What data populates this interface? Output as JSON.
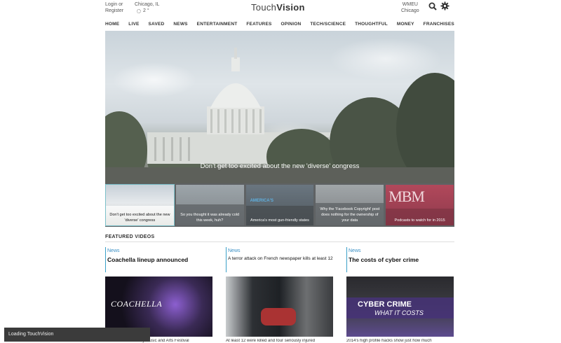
{
  "header": {
    "login_line1": "Login or",
    "login_line2": "Register",
    "location": "Chicago, IL",
    "temperature": "2 °",
    "logo_part1": "Touch",
    "logo_part2": "Vision",
    "station_line1": "WMEU",
    "station_line2": "Chicago"
  },
  "nav": {
    "items": [
      "HOME",
      "LIVE",
      "SAVED",
      "NEWS",
      "ENTERTAINMENT",
      "FEATURES",
      "OPINION",
      "TECH/SCIENCE",
      "THOUGHTFUL",
      "MONEY",
      "FRANCHISES"
    ]
  },
  "hero": {
    "caption": "Don't get too excited about the new 'diverse' congress"
  },
  "thumbnails": [
    {
      "caption": "Don't get too excited about the new 'diverse' congress"
    },
    {
      "caption": "So you thought it was already cold this week, huh?"
    },
    {
      "caption": "America's most gun-friendly states",
      "overlay": "AMERICA'S"
    },
    {
      "caption": "Why the 'Facebook Copyright' post does nothing for the ownership of your data"
    },
    {
      "caption": "Podcasts to watch for in 2015",
      "overlay": "MBM"
    }
  ],
  "featured": {
    "label": "FEATURED VIDEOS",
    "cards": [
      {
        "category": "News",
        "title": "Coachella lineup announced",
        "overlay": "COACHELLA",
        "sub": "The Coachella Valley Music and Arts Festival"
      },
      {
        "category": "News",
        "title": "A terror attack on French newspaper kills at least 12",
        "sub": "At least 12 were killed and four seriously injured"
      },
      {
        "category": "News",
        "title": "The costs of cyber crime",
        "overlay_line1": "CYBER CRIME",
        "overlay_line2": "WHAT IT COSTS",
        "sub": "2014's high profile hacks show just how much"
      }
    ]
  },
  "status": {
    "loading": "Loading TouchVision"
  },
  "colors": {
    "accent": "#3a8fc4",
    "thumb_active_border": "#7bc0c9",
    "loading_bg": "#3b3b3b"
  }
}
